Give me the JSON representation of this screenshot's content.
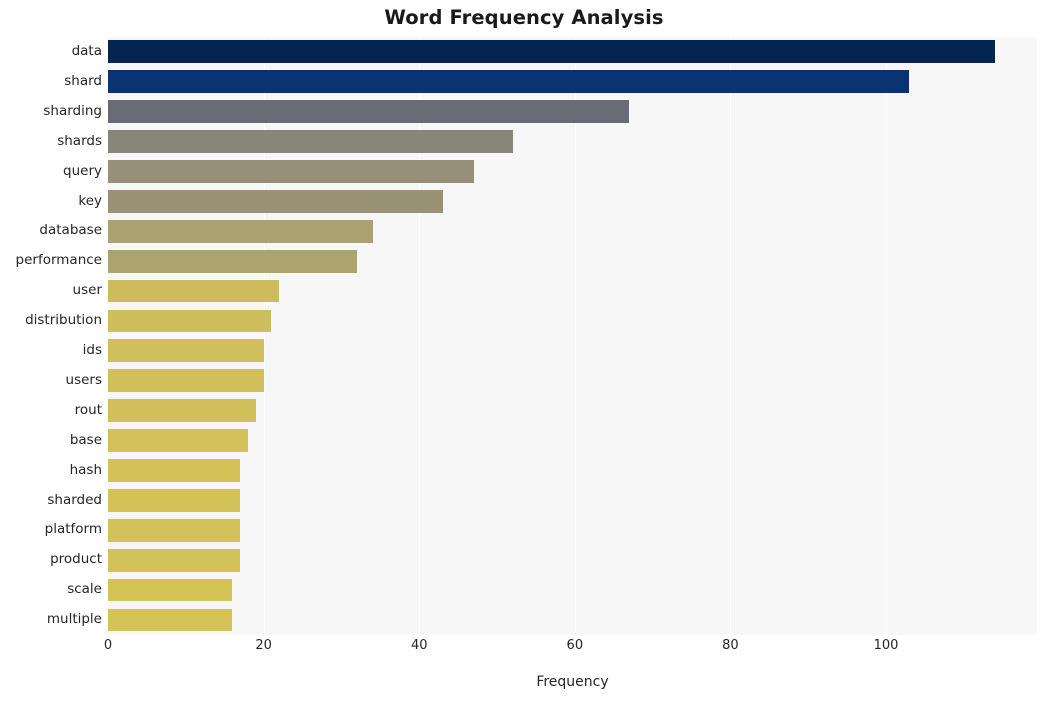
{
  "chart_data": {
    "type": "bar",
    "orientation": "horizontal",
    "title": "Word Frequency Analysis",
    "xlabel": "Frequency",
    "ylabel": "",
    "xlim": [
      0,
      119.4
    ],
    "xticks": [
      0,
      20,
      40,
      60,
      80,
      100
    ],
    "grid": true,
    "legend": false,
    "categories": [
      "data",
      "shard",
      "sharding",
      "shards",
      "query",
      "key",
      "database",
      "performance",
      "user",
      "distribution",
      "ids",
      "users",
      "rout",
      "base",
      "hash",
      "sharded",
      "platform",
      "product",
      "scale",
      "multiple"
    ],
    "values": [
      114,
      103,
      67,
      52,
      47,
      43,
      34,
      32,
      22,
      21,
      20,
      20,
      19,
      18,
      17,
      17,
      17,
      17,
      16,
      16
    ],
    "bar_colors": [
      "#032550",
      "#093470",
      "#696c74",
      "#868779",
      "#978f77",
      "#9a9275",
      "#aaa271",
      "#aca46f",
      "#ccbc5e",
      "#cfbe5c",
      "#d0bf5b",
      "#d0bf5b",
      "#d1c059",
      "#d2c158",
      "#d3c257",
      "#d3c257",
      "#d3c257",
      "#d3c257",
      "#d4c355",
      "#d4c355"
    ],
    "plot_background": "#f7f7f7",
    "gridline_color": "#ffffff",
    "figure_background": "#ffffff"
  }
}
